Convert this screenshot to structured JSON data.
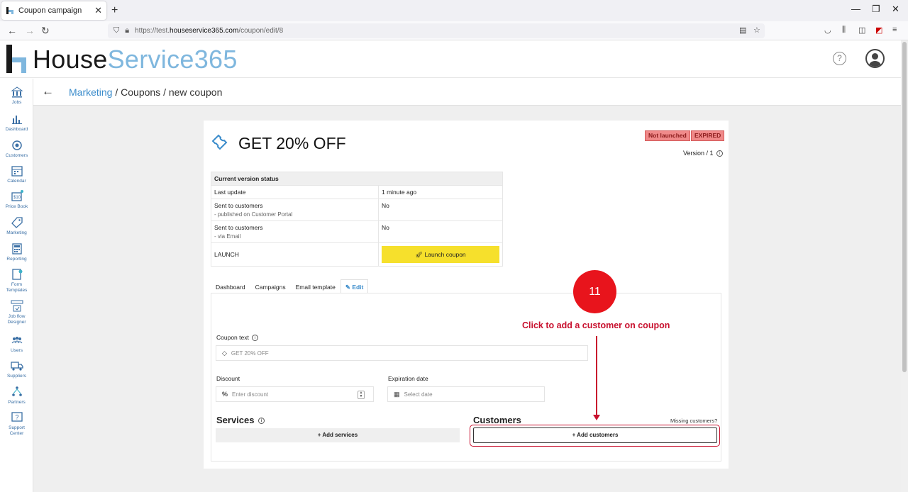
{
  "browser": {
    "tab_title": "Coupon campaign",
    "tab_close": "✕",
    "new_tab": "+",
    "url_prefix": "https://test.",
    "url_domain": "houseservice365.com",
    "url_path": "/coupon/edit/8"
  },
  "app": {
    "logo_part1": "House",
    "logo_part2": "Service365",
    "help": "?"
  },
  "sidebar": {
    "items": [
      {
        "label": "Jobs",
        "icon": "bank-icon"
      },
      {
        "label": "Dashboard",
        "icon": "bar-chart-icon"
      },
      {
        "label": "Customers",
        "icon": "target-icon"
      },
      {
        "label": "Calendar",
        "icon": "calendar-icon"
      },
      {
        "label": "Price Book",
        "icon": "price-tag-icon"
      },
      {
        "label": "Marketing",
        "icon": "tag-icon"
      },
      {
        "label": "Reporting",
        "icon": "calculator-icon"
      },
      {
        "label": "Form",
        "label2": "Templates",
        "icon": "form-icon"
      },
      {
        "label": "Job flow",
        "label2": "Designer",
        "icon": "flow-icon"
      },
      {
        "label": "Users",
        "icon": "users-icon"
      },
      {
        "label": "Suppliers",
        "icon": "truck-icon"
      },
      {
        "label": "Partners",
        "icon": "partners-icon"
      },
      {
        "label": "Support",
        "label2": "Center",
        "icon": "question-box-icon"
      }
    ]
  },
  "breadcrumb": {
    "link": "Marketing",
    "rest": " / Coupons / new coupon"
  },
  "coupon": {
    "title": "GET 20% OFF",
    "badge_not_launched": "Not launched",
    "badge_expired": "EXPIRED",
    "version": "Version / 1"
  },
  "status_table": {
    "header": "Current version status",
    "rows": [
      {
        "label": "Last update",
        "sub": "",
        "value": "1 minute ago"
      },
      {
        "label": "Sent to customers",
        "sub": "- published on Customer Portal",
        "value": "No"
      },
      {
        "label": "Sent to customers",
        "sub": "- via Email",
        "value": "No"
      }
    ],
    "launch_label": "LAUNCH",
    "launch_button": "Launch coupon"
  },
  "tabs": [
    "Dashboard",
    "Campaigns",
    "Email template",
    "Edit"
  ],
  "form": {
    "coupon_text_label": "Coupon text",
    "coupon_text_value": "GET 20% OFF",
    "discount_label": "Discount",
    "discount_placeholder": "Enter discount",
    "expiration_label": "Expiration date",
    "expiration_placeholder": "Select date",
    "services_heading": "Services",
    "add_services": "+ Add services",
    "customers_heading": "Customers",
    "missing_customers": "Missing customers?",
    "add_customers": "+ Add customers"
  },
  "annotation": {
    "step_number": "11",
    "text": "Click to add a customer on coupon"
  },
  "colors": {
    "accent": "#3b8ccb",
    "logo_blue": "#7fb7de",
    "launch_yellow": "#f6e02c",
    "badge_red": "#f08a8a",
    "annotation_red": "#c8102e"
  }
}
